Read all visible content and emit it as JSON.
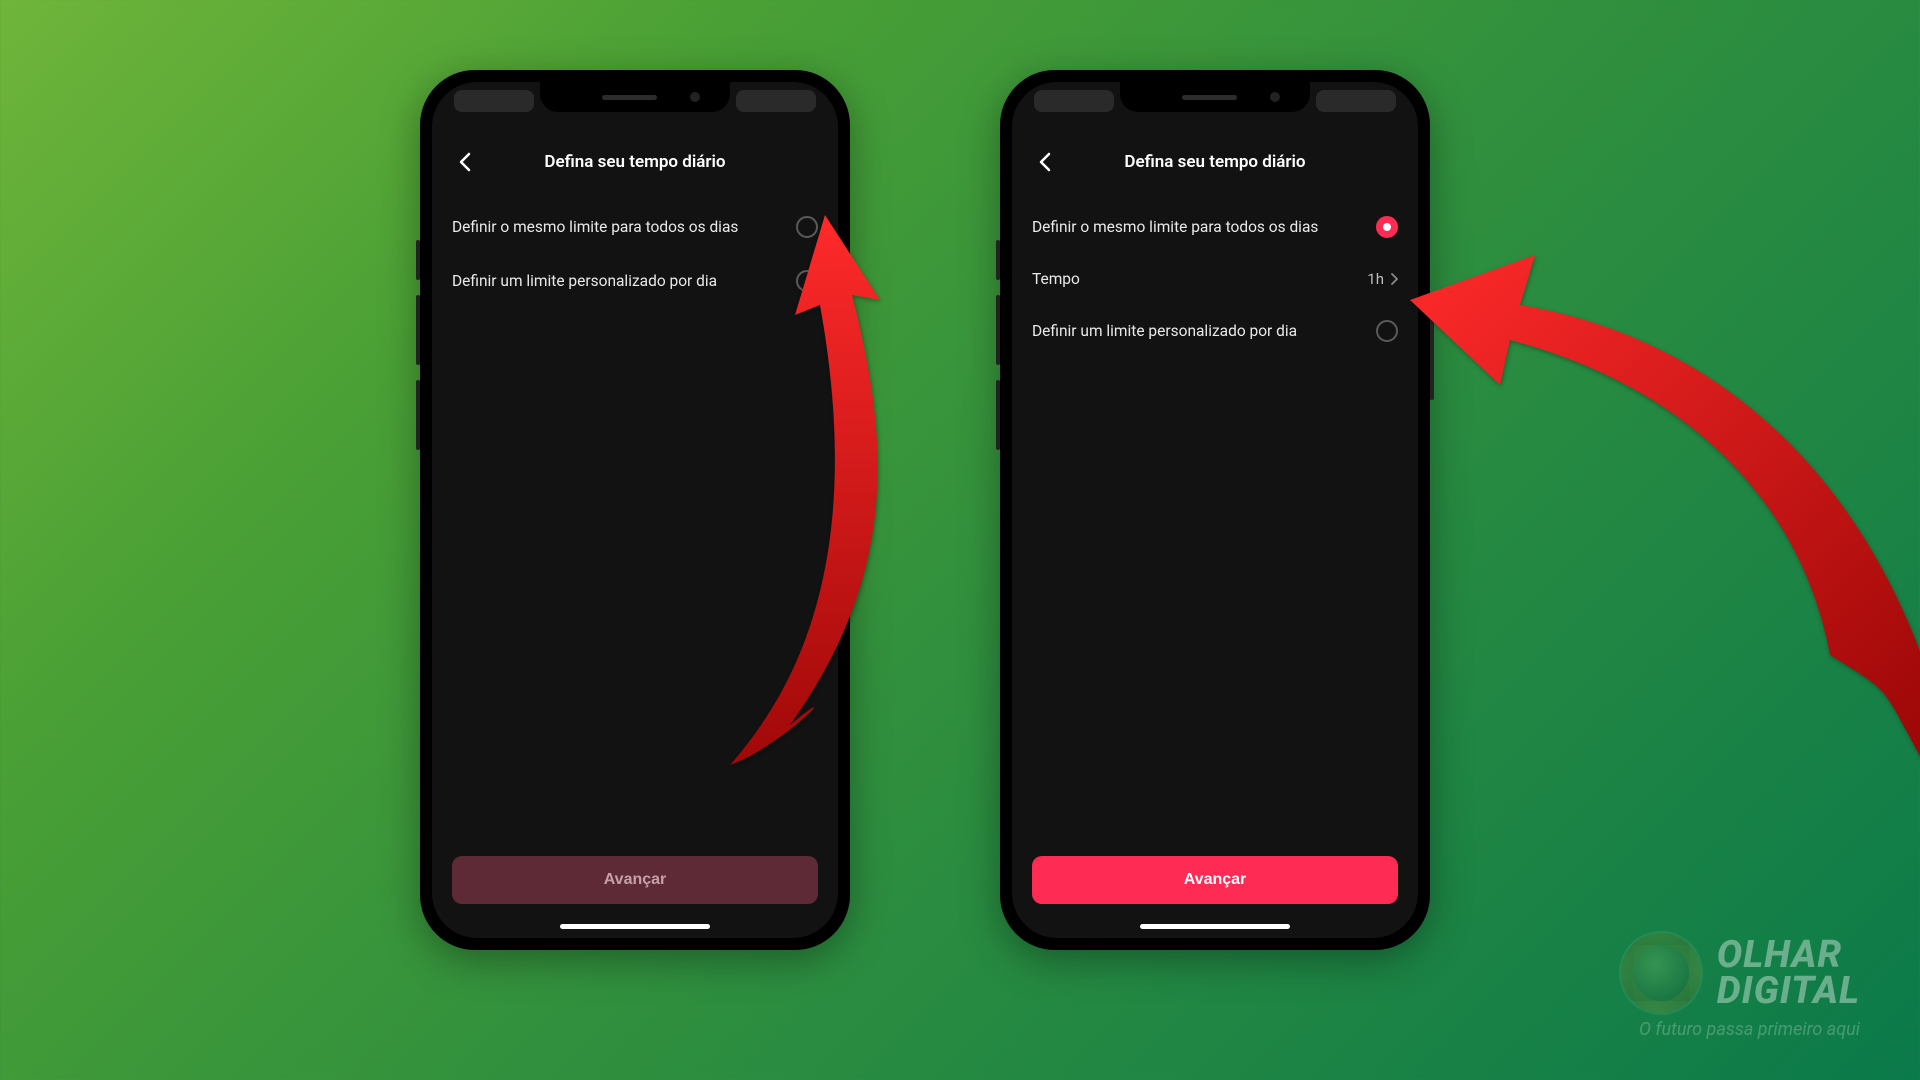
{
  "header": {
    "title": "Defina seu tempo diário"
  },
  "options": {
    "same_limit": "Definir o mesmo limite para todos os dias",
    "custom_limit": "Definir um limite personalizado por dia",
    "time_label": "Tempo",
    "time_value": "1h"
  },
  "footer": {
    "advance": "Avançar"
  },
  "watermark": {
    "line1": "OLHAR",
    "line2": "DIGITAL",
    "tag": "O futuro passa primeiro aqui"
  },
  "colors": {
    "accent": "#fe2c55",
    "arrow": "#c41212"
  }
}
